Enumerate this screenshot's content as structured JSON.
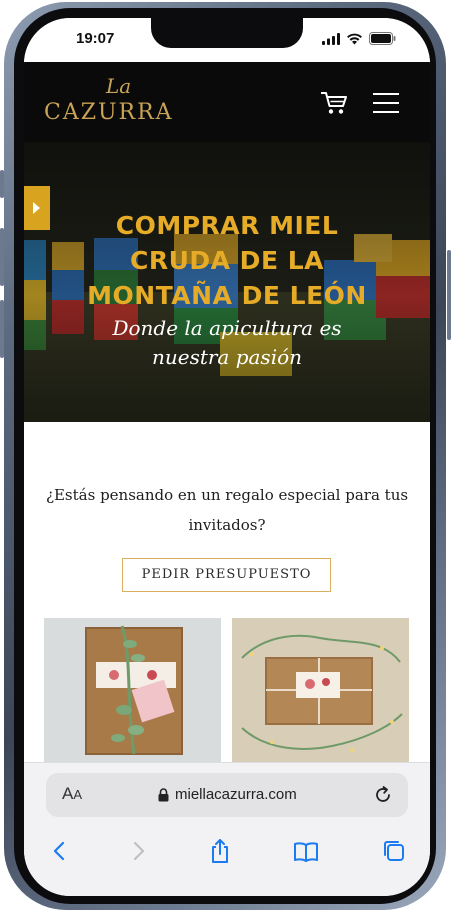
{
  "status_bar": {
    "time": "19:07"
  },
  "header": {
    "logo_prefix": "La",
    "logo_name": "CAZURRA",
    "cart_icon": "shopping-cart-icon",
    "menu_icon": "hamburger-menu-icon"
  },
  "hero": {
    "title_line1": "COMPRAR MIEL",
    "title_line2": "CRUDA DE LA",
    "title_line3": "MONTAÑA DE LEÓN",
    "subtitle_line1": "Donde la apicultura es",
    "subtitle_line2": "nuestra pasión",
    "side_tab_icon": "play-arrow-icon"
  },
  "content": {
    "question_line1": "¿Estás pensando en un regalo especial para tus",
    "question_line2": "invitados?",
    "quote_button": "PEDIR PRESUPUESTO"
  },
  "browser": {
    "aa_label_big": "A",
    "aa_label_small": "A",
    "url": "miellacazurra.com",
    "nav_icons": [
      "back-icon",
      "forward-icon",
      "share-icon",
      "bookmarks-icon",
      "tabs-icon"
    ]
  },
  "colors": {
    "brand_gold": "#c9a457",
    "hero_title": "#e6ac28",
    "button_border": "#d8b060",
    "safari_blue": "#1a7cf0"
  }
}
